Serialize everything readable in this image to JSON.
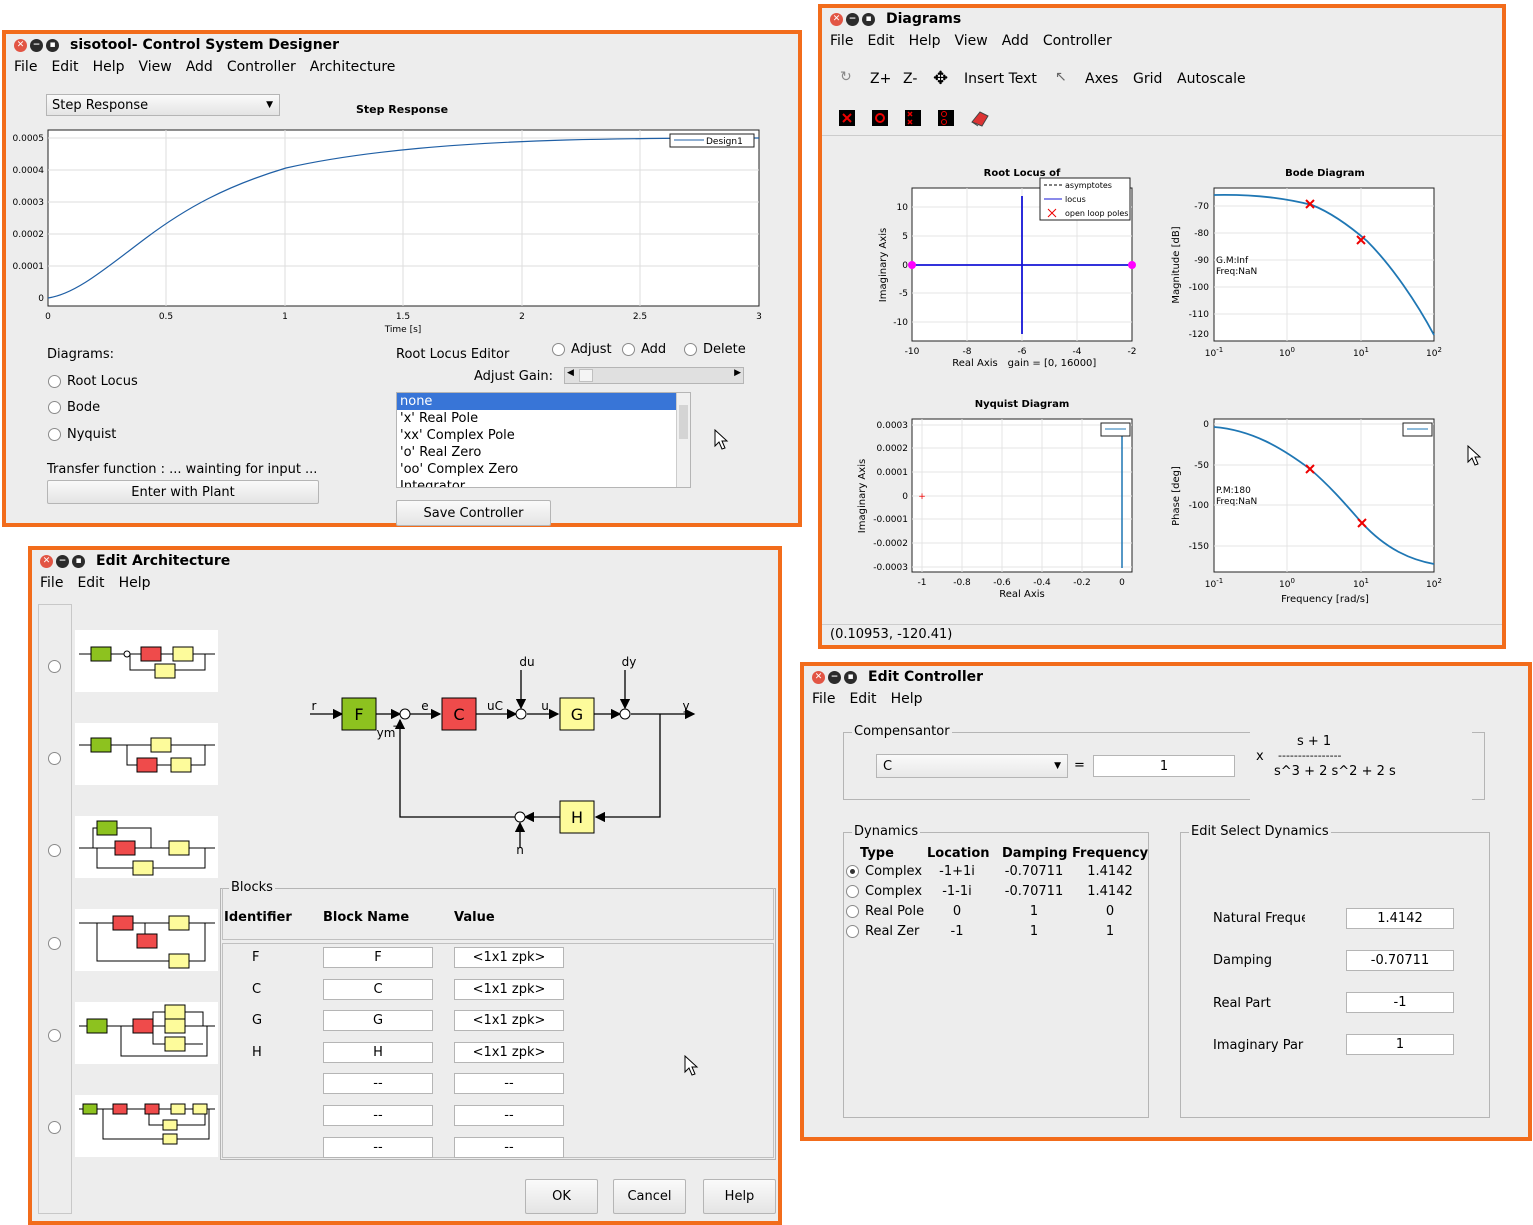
{
  "sisotool": {
    "title": "sisotool- Control System Designer",
    "menu": [
      "File",
      "Edit",
      "Help",
      "View",
      "Add",
      "Controller",
      "Architecture"
    ],
    "plot_select": "Step Response",
    "plot_title": "Step Response",
    "legend": "Design1",
    "xlabel": "Time [s]",
    "yticks": [
      "0.0005",
      "0.0004",
      "0.0003",
      "0.0002",
      "0.0001",
      "0"
    ],
    "xticks": [
      "0",
      "0.5",
      "1",
      "1.5",
      "2",
      "2.5",
      "3"
    ],
    "diagrams_label": "Diagrams:",
    "diagrams": [
      "Root Locus",
      "Bode",
      "Nyquist"
    ],
    "rle_label": "Root Locus Editor",
    "rle_options": [
      "Adjust",
      "Add",
      "Delete"
    ],
    "adjust_gain": "Adjust Gain:",
    "list": [
      "none",
      "'x' Real Pole",
      "'xx' Complex Pole",
      "'o' Real Zero",
      "'oo' Complex Zero",
      "Integrator"
    ],
    "transfer_text": "Transfer function : ... wainting for input ...",
    "enter_plant": "Enter with Plant",
    "save_controller": "Save Controller"
  },
  "diagrams": {
    "title": "Diagrams",
    "menu": [
      "File",
      "Edit",
      "Help",
      "View",
      "Add",
      "Controller"
    ],
    "toolbar": [
      "Z+",
      "Z-",
      "Insert Text",
      "Axes",
      "Grid",
      "Autoscale"
    ],
    "status": "(0.10953, -120.41)",
    "root_locus": {
      "title": "Root Locus of",
      "xlabel": "Real Axis",
      "gain_label": "gain = [0, 16000]",
      "ylabel": "Imaginary Axis",
      "xticks": [
        "-10",
        "-8",
        "-6",
        "-4",
        "-2"
      ],
      "yticks": [
        "10",
        "5",
        "0",
        "-5",
        "-10"
      ],
      "legend": [
        "asymptotes",
        "locus",
        "open loop poles"
      ]
    },
    "bode_mag": {
      "title": "Bode Diagram",
      "ylabel": "Magnitude [dB]",
      "yticks": [
        "-70",
        "-80",
        "-90",
        "-100",
        "-110",
        "-120"
      ],
      "gm": "G.M:Inf",
      "freq": "Freq:NaN"
    },
    "nyquist": {
      "title": "Nyquist Diagram",
      "xlabel": "Real Axis",
      "ylabel": "Imaginary Axis",
      "xticks": [
        "-1",
        "-0.8",
        "-0.6",
        "-0.4",
        "-0.2",
        "0"
      ],
      "yticks": [
        "0.0003",
        "0.0002",
        "0.0001",
        "0",
        "-0.0001",
        "-0.0002",
        "-0.0003"
      ]
    },
    "bode_phase": {
      "ylabel": "Phase [deg]",
      "xlabel": "Frequency [rad/s]",
      "yticks": [
        "0",
        "-50",
        "-100",
        "-150"
      ],
      "pm": "P.M:180",
      "freq": "Freq:NaN"
    },
    "bode_xticks": {
      "base": "10",
      "exps": [
        "-1",
        "0",
        "1",
        "2"
      ]
    }
  },
  "architecture": {
    "title": "Edit  Architecture",
    "menu": [
      "File",
      "Edit",
      "Help"
    ],
    "signals": {
      "r": "r",
      "e": "e",
      "uC": "uC",
      "u": "u",
      "y": "y",
      "du": "du",
      "dy": "dy",
      "ym": "ym",
      "n": "n"
    },
    "blocks_diagram": {
      "F": "F",
      "C": "C",
      "G": "G",
      "H": "H"
    },
    "blocks_group": "Blocks",
    "headers": [
      "Identifier",
      "Block Name",
      "Value"
    ],
    "rows": [
      {
        "id": "F",
        "name": "F",
        "value": "<1x1 zpk>"
      },
      {
        "id": "C",
        "name": "C",
        "value": "<1x1 zpk>"
      },
      {
        "id": "G",
        "name": "G",
        "value": "<1x1 zpk>"
      },
      {
        "id": "H",
        "name": "H",
        "value": "<1x1 zpk>"
      },
      {
        "id": "",
        "name": "--",
        "value": "--"
      },
      {
        "id": "",
        "name": "--",
        "value": "--"
      },
      {
        "id": "",
        "name": "--",
        "value": "--"
      }
    ],
    "ok": "OK",
    "cancel": "Cancel",
    "help": "Help"
  },
  "controller": {
    "title": "Edit Controller",
    "menu": [
      "File",
      "Edit",
      "Help"
    ],
    "compensator_label": "Compensantor",
    "comp_select": "C",
    "gain": "1",
    "x": "x",
    "numerator": "s + 1",
    "dash": "----------------",
    "denominator": "s^3 + 2 s^2 + 2 s",
    "dynamics_label": "Dynamics",
    "dyn_headers": [
      "Type",
      "Location",
      "Damping",
      "Frequency"
    ],
    "dyn_rows": [
      {
        "type": "Complex",
        "loc": "-1+1i",
        "damp": "-0.70711",
        "freq": "1.4142"
      },
      {
        "type": "Complex",
        "loc": "-1-1i",
        "damp": "-0.70711",
        "freq": "1.4142"
      },
      {
        "type": "Real Pole",
        "loc": "0",
        "damp": "1",
        "freq": "0"
      },
      {
        "type": "Real Zer",
        "loc": "-1",
        "damp": "1",
        "freq": "1"
      }
    ],
    "edit_label": "Edit Select Dynamics",
    "nat_freq_label": "Natural Freque",
    "nat_freq": "1.4142",
    "damping_label": "Damping",
    "damping": "-0.70711",
    "real_label": "Real Part",
    "real": "-1",
    "imag_label": "Imaginary Par",
    "imag": "1"
  },
  "colors": {
    "accent_border": "#f26c1b",
    "selection": "#3875d7",
    "block_green": "#8dc21f",
    "block_red": "#ef4b4b",
    "block_yellow": "#fdfb9b",
    "plot_blue": "#1f77b4"
  }
}
